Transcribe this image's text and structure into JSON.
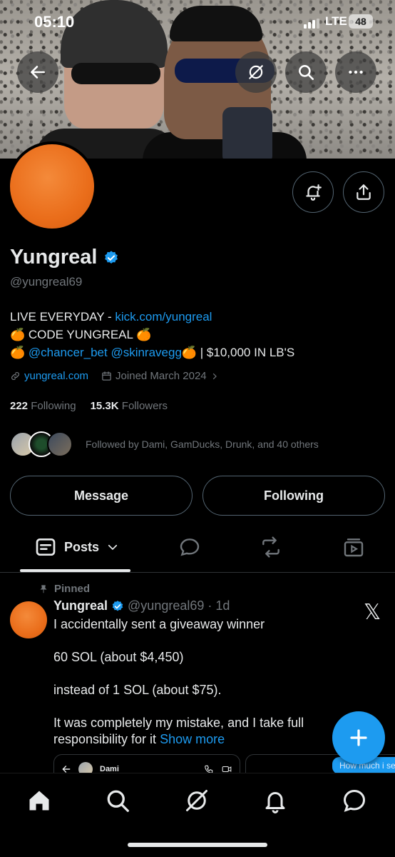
{
  "status_bar": {
    "time": "05:10",
    "network": "LTE",
    "battery": "48"
  },
  "banner_buttons": {
    "back": "back-arrow-icon",
    "grok": "grok-icon",
    "search": "search-icon",
    "more": "more-icon"
  },
  "profile": {
    "name": "Yungreal",
    "handle": "@yungreal69",
    "bio_line1_prefix": "LIVE EVERYDAY - ",
    "bio_line1_link": "kick.com/yungreal",
    "bio_line2": "🍊 CODE YUNGREAL 🍊",
    "bio_line3_emoji": "🍊 ",
    "bio_line3_links": "@chancer_bet @skinravegg",
    "bio_line3_suffix": "🍊 | $10,000 IN LB'S",
    "website": "yungreal.com",
    "joined": "Joined March 2024",
    "following_count": "222",
    "following_label": "Following",
    "followers_count": "15.3K",
    "followers_label": "Followers",
    "followed_by": "Followed by Dami, GamDucks, Drunk, and 40 others"
  },
  "actions": {
    "message": "Message",
    "following": "Following"
  },
  "tabs": {
    "posts": "Posts"
  },
  "post": {
    "pinned_label": "Pinned",
    "author": "Yungreal",
    "handle_time": "@yungreal69 · 1d",
    "line1": "I accidentally sent a giveaway winner",
    "line2": "60 SOL (about $4,450)",
    "line3": "instead of 1 SOL (about $75).",
    "line4": "It was completely my mistake, and I take full responsibility for it",
    "show_more": "Show more",
    "embed_name": "Dami",
    "bubble_text": "How much i se"
  },
  "colors": {
    "accent": "#1d9bf0",
    "orange": "#ea6d1a",
    "muted": "#71767b",
    "border": "#2f3336"
  }
}
